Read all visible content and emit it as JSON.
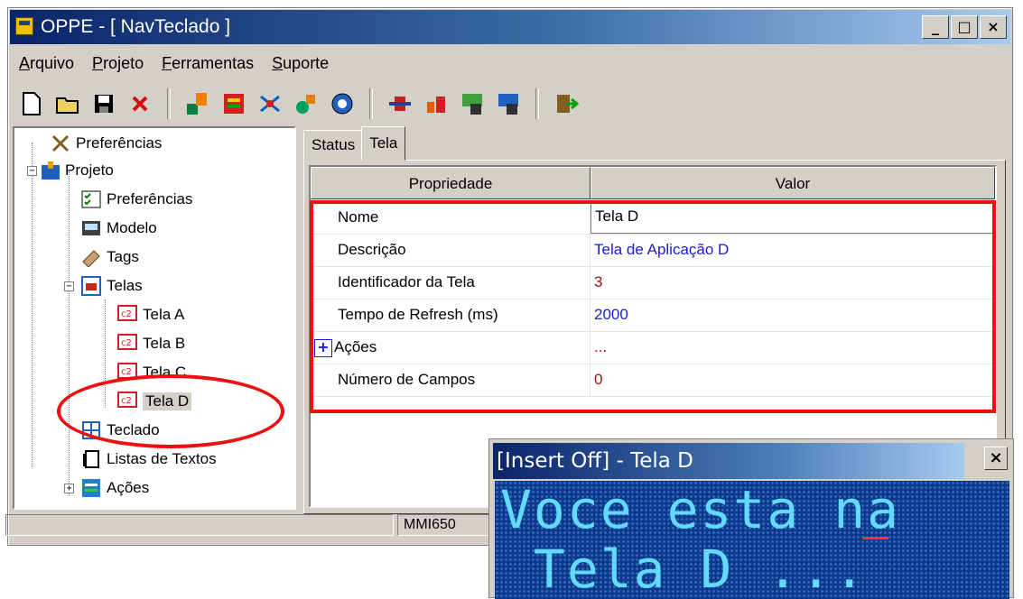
{
  "window": {
    "title": "OPPE - [ NavTeclado ]",
    "minimize": "_",
    "maximize": "□",
    "close": "×"
  },
  "menu": [
    "Arquivo",
    "Projeto",
    "Ferramentas",
    "Suporte"
  ],
  "toolbar_icons": [
    "new-icon",
    "open-icon",
    "save-icon",
    "delete-icon",
    "tool1-icon",
    "tool2-icon",
    "tool3-icon",
    "tool4-icon",
    "tool5-icon",
    "tool6-icon",
    "tool7-icon",
    "tool8-icon",
    "tool9-icon",
    "exit-icon"
  ],
  "tree": {
    "preferencias": "Preferências",
    "projeto": "Projeto",
    "proj_preferencias": "Preferências",
    "modelo": "Modelo",
    "tags": "Tags",
    "telas": "Telas",
    "tela_a": "Tela A",
    "tela_b": "Tela B",
    "tela_c": "Tela C",
    "tela_d": "Tela D",
    "teclado": "Teclado",
    "listas": "Listas de Textos",
    "acoes": "Ações"
  },
  "tabs": [
    "Status",
    "Tela"
  ],
  "grid": {
    "col_prop": "Propriedade",
    "col_valor": "Valor",
    "rows": [
      {
        "prop": "Nome",
        "value": "Tela D",
        "color": "#000000"
      },
      {
        "prop": "Descrição",
        "value": "Tela de Aplicação D",
        "color": "#1a1adc"
      },
      {
        "prop": "Identificador da Tela",
        "value": "3",
        "color": "#a01010"
      },
      {
        "prop": "Tempo de Refresh (ms)",
        "value": "2000",
        "color": "#1a1adc"
      },
      {
        "prop": "Ações",
        "value": "...",
        "color": "#a01010"
      },
      {
        "prop": "Número de Campos",
        "value": "0",
        "color": "#a01010"
      }
    ],
    "expand_symbol": "+"
  },
  "statusbar": {
    "model": "MMI650"
  },
  "popup": {
    "title": "[Insert Off] - Tela D",
    "close": "×",
    "line1": "Voce esta na",
    "line2": " Tela D ..."
  },
  "colors": {
    "highlight": "#ee1010",
    "lcd_bg": "#0a3a8c",
    "lcd_text": "#63d9ff"
  }
}
